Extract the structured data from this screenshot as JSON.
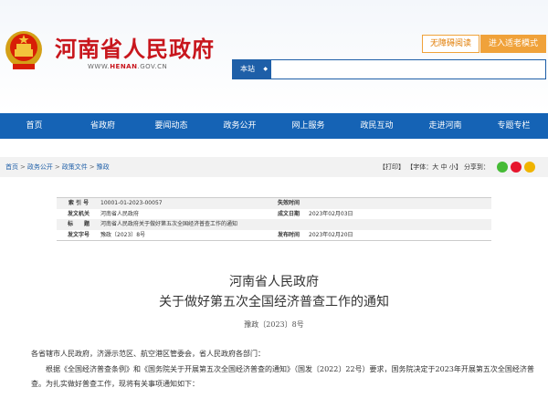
{
  "header": {
    "site_title": "河南省人民政府",
    "site_url_prefix": "WWW.",
    "site_url_accent": "HENAN",
    "site_url_suffix": ".GOV.CN",
    "accessibility_label": "无障碍阅读",
    "elder_mode_label": "进入适老模式",
    "search_scope": "本站",
    "search_placeholder": ""
  },
  "nav": {
    "items": [
      {
        "label": "首页"
      },
      {
        "label": "省政府"
      },
      {
        "label": "要闻动态"
      },
      {
        "label": "政务公开"
      },
      {
        "label": "网上服务"
      },
      {
        "label": "政民互动"
      },
      {
        "label": "走进河南"
      },
      {
        "label": "专题专栏"
      }
    ]
  },
  "breadcrumb": {
    "items": [
      "首页",
      "政务公开",
      "政策文件",
      "豫政"
    ],
    "separator": ">"
  },
  "tools": {
    "print": "【打印】",
    "font_label": "【字体：",
    "font_large": "大",
    "font_medium": "中",
    "font_small": "小",
    "font_close": "】",
    "share_label": "分享到："
  },
  "meta": {
    "index_label": "索 引 号",
    "index_value": "10001-01-2023-00057",
    "expiry_label": "失效时间",
    "expiry_value": "",
    "issuer_label": "发文机关",
    "issuer_value": "河南省人民政府",
    "date_label": "成文日期",
    "date_value": "2023年02月03日",
    "title_label": "标　　题",
    "title_value": "河南省人民政府关于做好第五次全国经济普查工作的通知",
    "docno_label": "发文字号",
    "docno_value": "豫政〔2023〕8号",
    "publish_label": "发布时间",
    "publish_value": "2023年02月20日"
  },
  "document": {
    "title_line1": "河南省人民政府",
    "title_line2": "关于做好第五次全国经济普查工作的通知",
    "doc_number": "豫政〔2023〕8号",
    "salutation": "各省辖市人民政府，济源示范区、航空港区管委会，省人民政府各部门：",
    "paragraph1": "根据《全国经济普查条例》和《国务院关于开展第五次全国经济普查的通知》（国发〔2022〕22号）要求，国务院决定于2023年开展第五次全国经济普查。为扎实做好普查工作，现将有关事项通知如下："
  },
  "colors": {
    "brand_red": "#c8161d",
    "nav_blue": "#1563b5",
    "accent_orange": "#f0a23a"
  }
}
